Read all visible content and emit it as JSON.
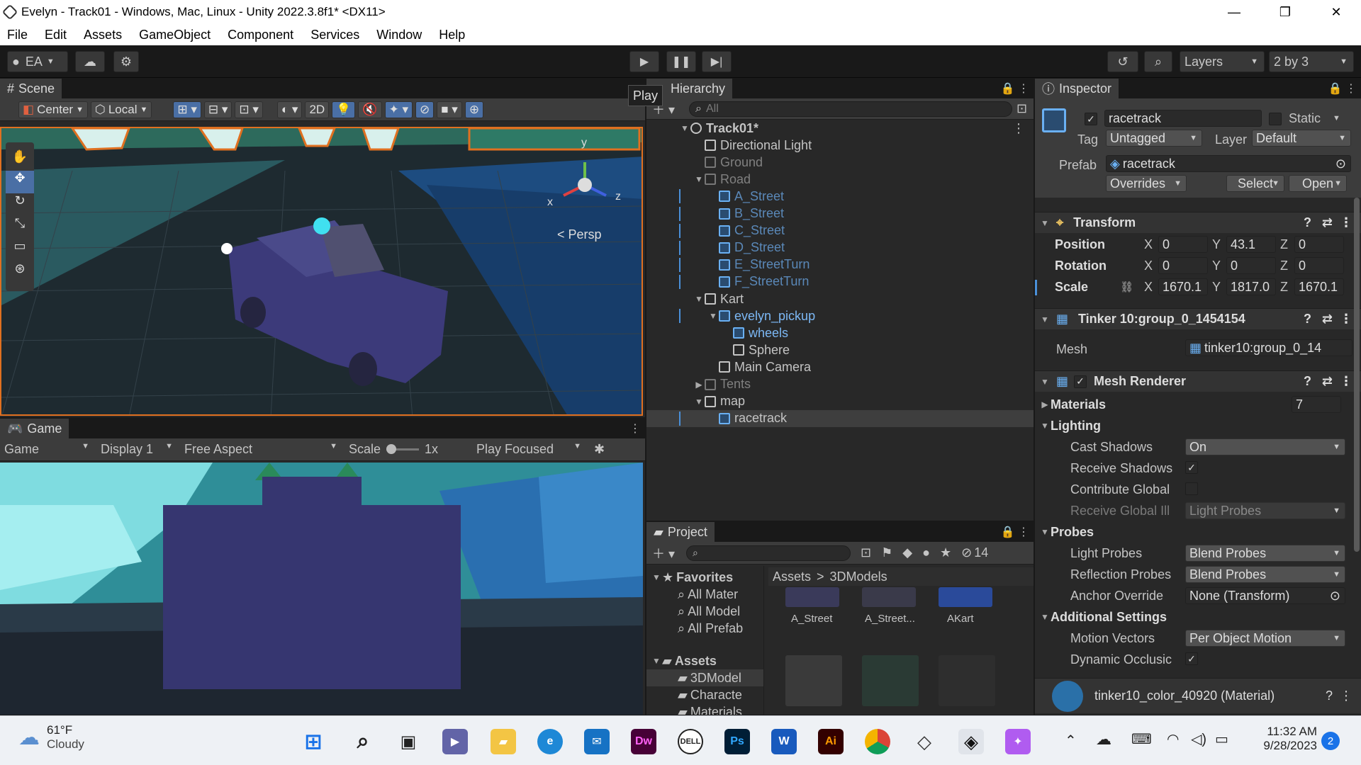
{
  "window": {
    "title": "Evelyn - Track01 - Windows, Mac, Linux - Unity 2022.3.8f1* <DX11>",
    "minimize": "—",
    "maximize": "❐",
    "close": "✕"
  },
  "menu": [
    "File",
    "Edit",
    "Assets",
    "GameObject",
    "Component",
    "Services",
    "Window",
    "Help"
  ],
  "toolbar": {
    "account": "EA",
    "layers": "Layers",
    "layout": "2 by 3",
    "play_tooltip": "Play"
  },
  "scene": {
    "tab": "Scene",
    "pivot": "Center",
    "space": "Local",
    "mode2d": "2D",
    "persp": "Persp",
    "axis_x": "x",
    "axis_y": "y",
    "axis_z": "z"
  },
  "game": {
    "tab": "Game",
    "view": "Game",
    "display": "Display 1",
    "aspect": "Free Aspect",
    "scale_label": "Scale",
    "scale_value": "1x",
    "play_mode": "Play Focused"
  },
  "hierarchy": {
    "tab": "Hierarchy",
    "search_placeholder": "All",
    "items": [
      {
        "label": "Track01*",
        "indent": 0,
        "arrow": "▼",
        "style": "scene"
      },
      {
        "label": "Directional Light",
        "indent": 1,
        "arrow": "",
        "style": "normal"
      },
      {
        "label": "Ground",
        "indent": 1,
        "arrow": "",
        "style": "dim"
      },
      {
        "label": "Road",
        "indent": 1,
        "arrow": "▼",
        "style": "dim"
      },
      {
        "label": "A_Street",
        "indent": 2,
        "arrow": "",
        "style": "prefab-dim"
      },
      {
        "label": "B_Street",
        "indent": 2,
        "arrow": "",
        "style": "prefab-dim"
      },
      {
        "label": "C_Street",
        "indent": 2,
        "arrow": "",
        "style": "prefab-dim"
      },
      {
        "label": "D_Street",
        "indent": 2,
        "arrow": "",
        "style": "prefab-dim"
      },
      {
        "label": "E_StreetTurn",
        "indent": 2,
        "arrow": "",
        "style": "prefab-dim"
      },
      {
        "label": "F_StreetTurn",
        "indent": 2,
        "arrow": "",
        "style": "prefab-dim"
      },
      {
        "label": "Kart",
        "indent": 1,
        "arrow": "▼",
        "style": "normal"
      },
      {
        "label": "evelyn_pickup",
        "indent": 2,
        "arrow": "▼",
        "style": "prefab"
      },
      {
        "label": "wheels",
        "indent": 3,
        "arrow": "",
        "style": "prefab-child"
      },
      {
        "label": "Sphere",
        "indent": 3,
        "arrow": "",
        "style": "normal"
      },
      {
        "label": "Main Camera",
        "indent": 2,
        "arrow": "",
        "style": "normal"
      },
      {
        "label": "Tents",
        "indent": 1,
        "arrow": "▶",
        "style": "dim"
      },
      {
        "label": "map",
        "indent": 1,
        "arrow": "▼",
        "style": "normal"
      },
      {
        "label": "racetrack",
        "indent": 2,
        "arrow": "",
        "style": "selected"
      }
    ]
  },
  "project": {
    "tab": "Project",
    "hidden_count": "14",
    "breadcrumb_root": "Assets",
    "breadcrumb_sep": ">",
    "breadcrumb_current": "3DModels",
    "favorites_label": "Favorites",
    "favorites": [
      "All Mater",
      "All Model",
      "All Prefab"
    ],
    "assets_label": "Assets",
    "folders": [
      "3DModel",
      "Characte",
      "Materials"
    ],
    "grid": [
      "A_Street",
      "A_Street...",
      "AKart"
    ]
  },
  "inspector": {
    "tab": "Inspector",
    "name": "racetrack",
    "static_label": "Static",
    "tag_label": "Tag",
    "tag": "Untagged",
    "layer_label": "Layer",
    "layer": "Default",
    "prefab_label": "Prefab",
    "prefab": "racetrack",
    "overrides": "Overrides",
    "select": "Select",
    "open": "Open",
    "transform": {
      "title": "Transform",
      "position_label": "Position",
      "rotation_label": "Rotation",
      "scale_label": "Scale",
      "position": [
        "0",
        "43.1",
        "0"
      ],
      "rotation": [
        "0",
        "0",
        "0"
      ],
      "scale": [
        "1670.1",
        "1817.0",
        "1670.1"
      ],
      "axes": [
        "X",
        "Y",
        "Z"
      ]
    },
    "mesh_filter": {
      "title": "Tinker 10:group_0_1454154",
      "mesh_label": "Mesh",
      "mesh": "tinker10:group_0_14"
    },
    "mesh_renderer": {
      "title": "Mesh Renderer",
      "materials_label": "Materials",
      "materials_count": "7",
      "lighting_label": "Lighting",
      "cast_shadows_label": "Cast Shadows",
      "cast_shadows": "On",
      "receive_shadows_label": "Receive Shadows",
      "contribute_global_label": "Contribute Global",
      "receive_global_label": "Receive Global Ill",
      "receive_global": "Light Probes",
      "probes_label": "Probes",
      "light_probes_label": "Light Probes",
      "light_probes": "Blend Probes",
      "reflection_probes_label": "Reflection Probes",
      "reflection_probes": "Blend Probes",
      "anchor_label": "Anchor Override",
      "anchor": "None (Transform)",
      "additional_label": "Additional Settings",
      "motion_vectors_label": "Motion Vectors",
      "motion_vectors": "Per Object Motion",
      "dynamic_occlusion_label": "Dynamic Occlusic"
    },
    "material": "tinker10_color_40920 (Material)"
  },
  "taskbar": {
    "temp": "61°F",
    "weather": "Cloudy",
    "time": "11:32 AM",
    "date": "9/28/2023",
    "notifications": "2",
    "apps": [
      "Dw",
      "Ps",
      "W",
      "Ai"
    ]
  }
}
